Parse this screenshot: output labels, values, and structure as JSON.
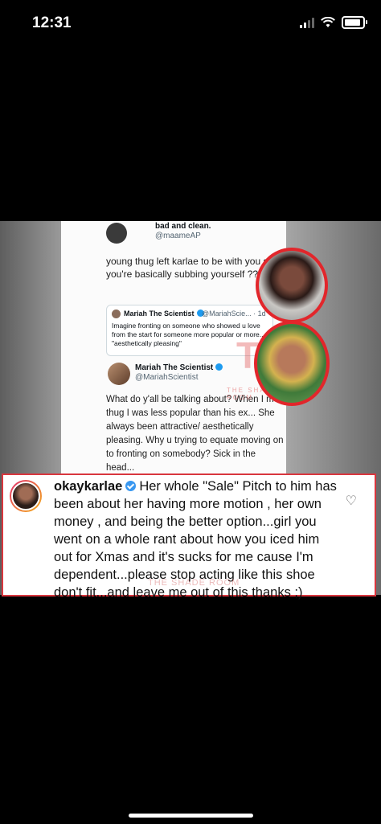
{
  "status_bar": {
    "time": "12:31"
  },
  "tweet": {
    "author_name": "bad and clean.",
    "author_handle": "@maameAP",
    "body": "young thug left karlae to be with you so you're basically subbing yourself ???",
    "quoted": {
      "author_name": "Mariah The Scientist",
      "author_handle": "@MariahScie... · 1d",
      "body": "Imagine fronting on someone who showed u love from the start for someone more popular or more... \"aesthetically pleasing\""
    },
    "reply": {
      "author_name": "Mariah The Scientist",
      "author_handle": "@MariahScientist",
      "body": "What do y'all be talking about? When I met thug I was less popular than his ex... She always been attractive/ aesthetically pleasing. Why u trying to equate moving on to fronting on somebody? Sick in the head..."
    },
    "watermark": "TSR",
    "watermark_sub": "THE SHADE ROOM"
  },
  "comment": {
    "username": "okaykarlae",
    "text": "Her whole \"Sale\" Pitch to him has been about her having more motion , her own money , and being the better option...girl you went on a whole rant about how you iced him out for Xmas and it's sucks for me cause I'm dependent...please stop acting like this shoe don't fit...and leave me out of this thanks ;)",
    "watermark": "THE SHADE ROOM"
  },
  "icons": {
    "like": "heart-icon",
    "verified": "verified-badge-icon"
  },
  "colors": {
    "highlight_border": "#d9363e",
    "verified": "#3897f0"
  }
}
